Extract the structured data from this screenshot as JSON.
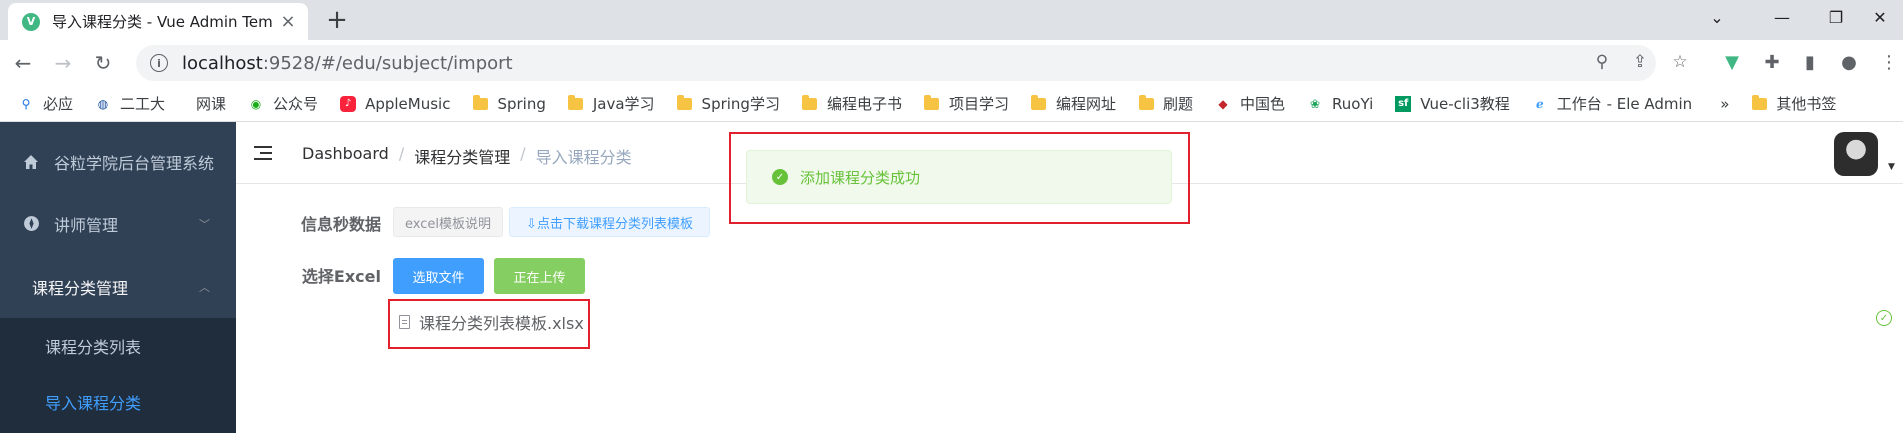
{
  "browser": {
    "tab_title": "导入课程分类 - Vue Admin Tem",
    "tab_favicon_letter": "V",
    "url_host": "localhost",
    "url_rest": ":9528/#/edu/subject/import",
    "bookmarks": [
      {
        "label": "必应",
        "icon": "search-icon"
      },
      {
        "label": "二工大",
        "icon": "school-logo-icon"
      },
      {
        "label": "网课",
        "icon": "blank-icon"
      },
      {
        "label": "公众号",
        "icon": "wechat-icon"
      },
      {
        "label": "AppleMusic",
        "icon": "music-icon"
      },
      {
        "label": "Spring",
        "icon": "folder-icon"
      },
      {
        "label": "Java学习",
        "icon": "folder-icon"
      },
      {
        "label": "Spring学习",
        "icon": "folder-icon"
      },
      {
        "label": "编程电子书",
        "icon": "folder-icon"
      },
      {
        "label": "项目学习",
        "icon": "folder-icon"
      },
      {
        "label": "编程网址",
        "icon": "folder-icon"
      },
      {
        "label": "刷题",
        "icon": "folder-icon"
      },
      {
        "label": "中国色",
        "icon": "color-icon"
      },
      {
        "label": "RuoYi",
        "icon": "ruoyi-icon"
      },
      {
        "label": "Vue-cli3教程",
        "icon": "sf-icon"
      },
      {
        "label": "工作台 - Ele Admin",
        "icon": "ele-icon"
      }
    ],
    "bookmarks_overflow": "»",
    "other_bookmarks": "其他书签"
  },
  "sidebar": {
    "app_title": "谷粒学院后台管理系统",
    "items": [
      {
        "label": "讲师管理"
      },
      {
        "label": "课程分类管理"
      }
    ],
    "sub_items": [
      {
        "label": "课程分类列表"
      },
      {
        "label": "导入课程分类"
      }
    ]
  },
  "breadcrumb": {
    "home": "Dashboard",
    "parent": "课程分类管理",
    "current": "导入课程分类",
    "separator": "/"
  },
  "form": {
    "info_label": "信息秒数据",
    "excel_note_btn": "excel模板说明",
    "download_btn": "⇩点击下载课程分类列表模板",
    "select_label": "选择Excel",
    "choose_file_btn": "选取文件",
    "upload_btn": "正在上传",
    "file_name": "课程分类列表模板.xlsx"
  },
  "message": {
    "text": "添加课程分类成功"
  },
  "colors": {
    "sidebar_bg": "#304156",
    "sidebar_sub_bg": "#1f2d3d",
    "primary": "#409eff",
    "success": "#67c23a",
    "highlight": "#e0202c"
  }
}
